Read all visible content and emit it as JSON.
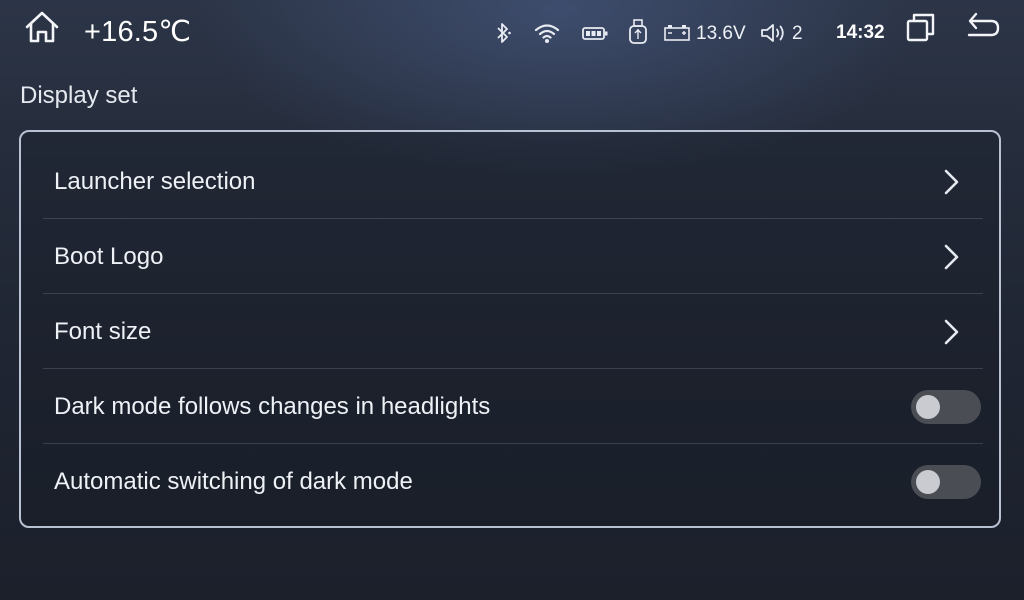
{
  "status_bar": {
    "temperature": "+16.5℃",
    "voltage": "13.6V",
    "volume_level": "2",
    "time": "14:32",
    "icons": [
      "home-icon",
      "bluetooth-icon",
      "wifi-icon",
      "battery-icon",
      "usb-icon",
      "car-battery-icon",
      "volume-icon",
      "multi-window-icon",
      "back-icon"
    ]
  },
  "page": {
    "title": "Display set"
  },
  "settings": {
    "items": [
      {
        "label": "Launcher selection",
        "control": "chevron"
      },
      {
        "label": "Boot Logo",
        "control": "chevron"
      },
      {
        "label": "Font size",
        "control": "chevron"
      },
      {
        "label": "Dark mode follows changes in headlights",
        "control": "toggle",
        "on": false
      },
      {
        "label": "Automatic switching of dark mode",
        "control": "toggle",
        "on": false
      }
    ]
  },
  "colors": {
    "panel_border": "#b9c2d2",
    "toggle_off_track": "#4a4d53",
    "toggle_knob": "#c9cbd0"
  }
}
